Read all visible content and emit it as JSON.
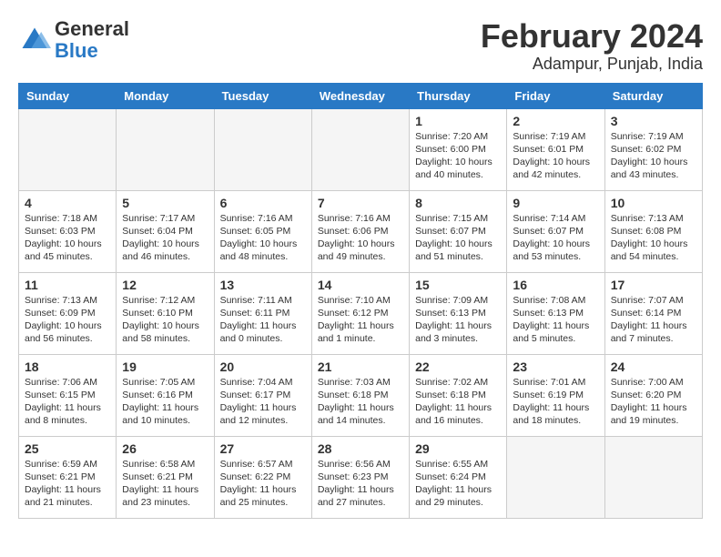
{
  "logo": {
    "general": "General",
    "blue": "Blue"
  },
  "title": "February 2024",
  "subtitle": "Adampur, Punjab, India",
  "days_of_week": [
    "Sunday",
    "Monday",
    "Tuesday",
    "Wednesday",
    "Thursday",
    "Friday",
    "Saturday"
  ],
  "weeks": [
    [
      {
        "day": "",
        "empty": true
      },
      {
        "day": "",
        "empty": true
      },
      {
        "day": "",
        "empty": true
      },
      {
        "day": "",
        "empty": true
      },
      {
        "day": "1",
        "sunrise": "7:20 AM",
        "sunset": "6:00 PM",
        "daylight": "10 hours and 40 minutes."
      },
      {
        "day": "2",
        "sunrise": "7:19 AM",
        "sunset": "6:01 PM",
        "daylight": "10 hours and 42 minutes."
      },
      {
        "day": "3",
        "sunrise": "7:19 AM",
        "sunset": "6:02 PM",
        "daylight": "10 hours and 43 minutes."
      }
    ],
    [
      {
        "day": "4",
        "sunrise": "7:18 AM",
        "sunset": "6:03 PM",
        "daylight": "10 hours and 45 minutes."
      },
      {
        "day": "5",
        "sunrise": "7:17 AM",
        "sunset": "6:04 PM",
        "daylight": "10 hours and 46 minutes."
      },
      {
        "day": "6",
        "sunrise": "7:16 AM",
        "sunset": "6:05 PM",
        "daylight": "10 hours and 48 minutes."
      },
      {
        "day": "7",
        "sunrise": "7:16 AM",
        "sunset": "6:06 PM",
        "daylight": "10 hours and 49 minutes."
      },
      {
        "day": "8",
        "sunrise": "7:15 AM",
        "sunset": "6:07 PM",
        "daylight": "10 hours and 51 minutes."
      },
      {
        "day": "9",
        "sunrise": "7:14 AM",
        "sunset": "6:07 PM",
        "daylight": "10 hours and 53 minutes."
      },
      {
        "day": "10",
        "sunrise": "7:13 AM",
        "sunset": "6:08 PM",
        "daylight": "10 hours and 54 minutes."
      }
    ],
    [
      {
        "day": "11",
        "sunrise": "7:13 AM",
        "sunset": "6:09 PM",
        "daylight": "10 hours and 56 minutes."
      },
      {
        "day": "12",
        "sunrise": "7:12 AM",
        "sunset": "6:10 PM",
        "daylight": "10 hours and 58 minutes."
      },
      {
        "day": "13",
        "sunrise": "7:11 AM",
        "sunset": "6:11 PM",
        "daylight": "11 hours and 0 minutes."
      },
      {
        "day": "14",
        "sunrise": "7:10 AM",
        "sunset": "6:12 PM",
        "daylight": "11 hours and 1 minute."
      },
      {
        "day": "15",
        "sunrise": "7:09 AM",
        "sunset": "6:13 PM",
        "daylight": "11 hours and 3 minutes."
      },
      {
        "day": "16",
        "sunrise": "7:08 AM",
        "sunset": "6:13 PM",
        "daylight": "11 hours and 5 minutes."
      },
      {
        "day": "17",
        "sunrise": "7:07 AM",
        "sunset": "6:14 PM",
        "daylight": "11 hours and 7 minutes."
      }
    ],
    [
      {
        "day": "18",
        "sunrise": "7:06 AM",
        "sunset": "6:15 PM",
        "daylight": "11 hours and 8 minutes."
      },
      {
        "day": "19",
        "sunrise": "7:05 AM",
        "sunset": "6:16 PM",
        "daylight": "11 hours and 10 minutes."
      },
      {
        "day": "20",
        "sunrise": "7:04 AM",
        "sunset": "6:17 PM",
        "daylight": "11 hours and 12 minutes."
      },
      {
        "day": "21",
        "sunrise": "7:03 AM",
        "sunset": "6:18 PM",
        "daylight": "11 hours and 14 minutes."
      },
      {
        "day": "22",
        "sunrise": "7:02 AM",
        "sunset": "6:18 PM",
        "daylight": "11 hours and 16 minutes."
      },
      {
        "day": "23",
        "sunrise": "7:01 AM",
        "sunset": "6:19 PM",
        "daylight": "11 hours and 18 minutes."
      },
      {
        "day": "24",
        "sunrise": "7:00 AM",
        "sunset": "6:20 PM",
        "daylight": "11 hours and 19 minutes."
      }
    ],
    [
      {
        "day": "25",
        "sunrise": "6:59 AM",
        "sunset": "6:21 PM",
        "daylight": "11 hours and 21 minutes."
      },
      {
        "day": "26",
        "sunrise": "6:58 AM",
        "sunset": "6:21 PM",
        "daylight": "11 hours and 23 minutes."
      },
      {
        "day": "27",
        "sunrise": "6:57 AM",
        "sunset": "6:22 PM",
        "daylight": "11 hours and 25 minutes."
      },
      {
        "day": "28",
        "sunrise": "6:56 AM",
        "sunset": "6:23 PM",
        "daylight": "11 hours and 27 minutes."
      },
      {
        "day": "29",
        "sunrise": "6:55 AM",
        "sunset": "6:24 PM",
        "daylight": "11 hours and 29 minutes."
      },
      {
        "day": "",
        "empty": true
      },
      {
        "day": "",
        "empty": true
      }
    ]
  ]
}
